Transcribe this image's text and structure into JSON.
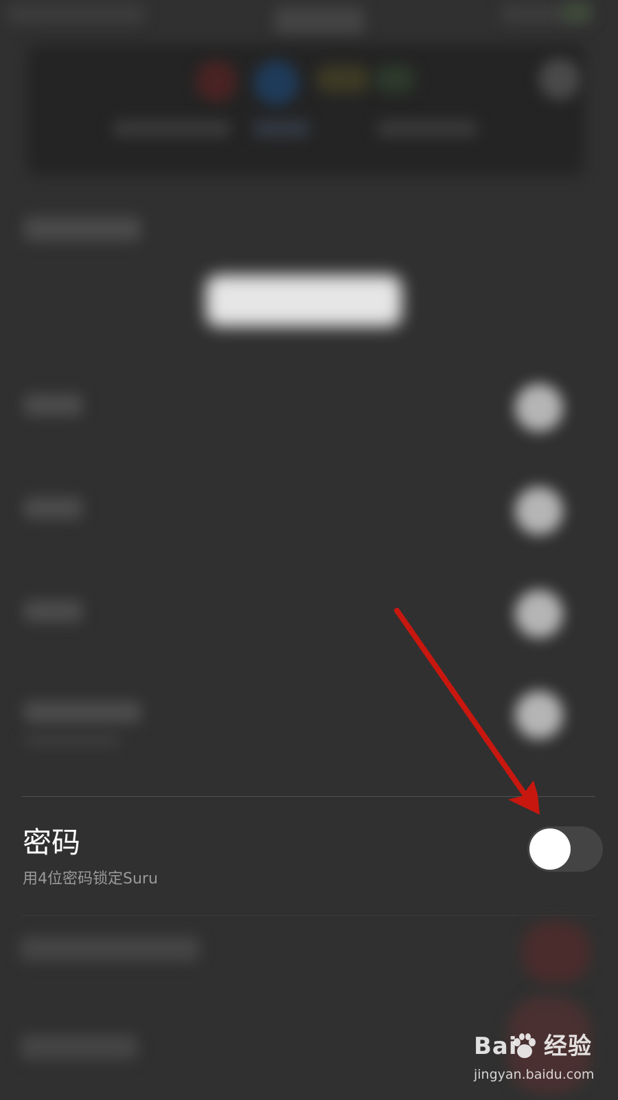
{
  "setting": {
    "title": "密码",
    "subtitle": "用4位密码锁定Suru",
    "toggle_on": false
  },
  "colors": {
    "background": "#303030",
    "toggle_track": "#444444",
    "toggle_knob": "#ffffff",
    "annotation_arrow": "#c8170f"
  },
  "watermark": {
    "brand": "Bai   经验",
    "url": "jingyan.baidu.com"
  }
}
